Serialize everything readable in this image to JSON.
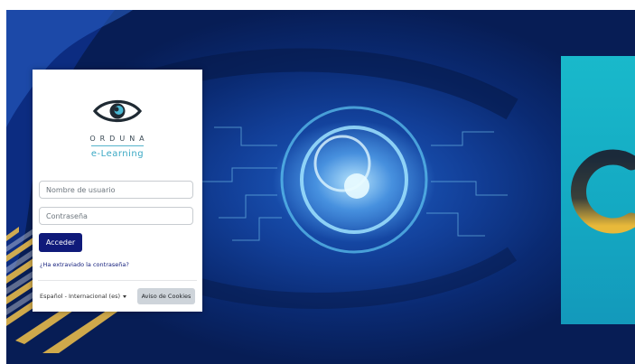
{
  "brand": {
    "name": "ORDUNA",
    "subtitle": "e-Learning",
    "logo_icon": "eye-logo-icon"
  },
  "login": {
    "username_placeholder": "Nombre de usuario",
    "password_placeholder": "Contraseña",
    "submit_label": "Acceder",
    "forgot_link": "¿Ha extraviado la contraseña?"
  },
  "footer": {
    "language_selected": "Español - Internacional (es)",
    "cookie_button": "Aviso de Cookies"
  },
  "colors": {
    "primary": "#0f1a7a",
    "accent": "#3aa8c4",
    "teal_panel": "#19b9cb",
    "background": "#0a2a72"
  }
}
